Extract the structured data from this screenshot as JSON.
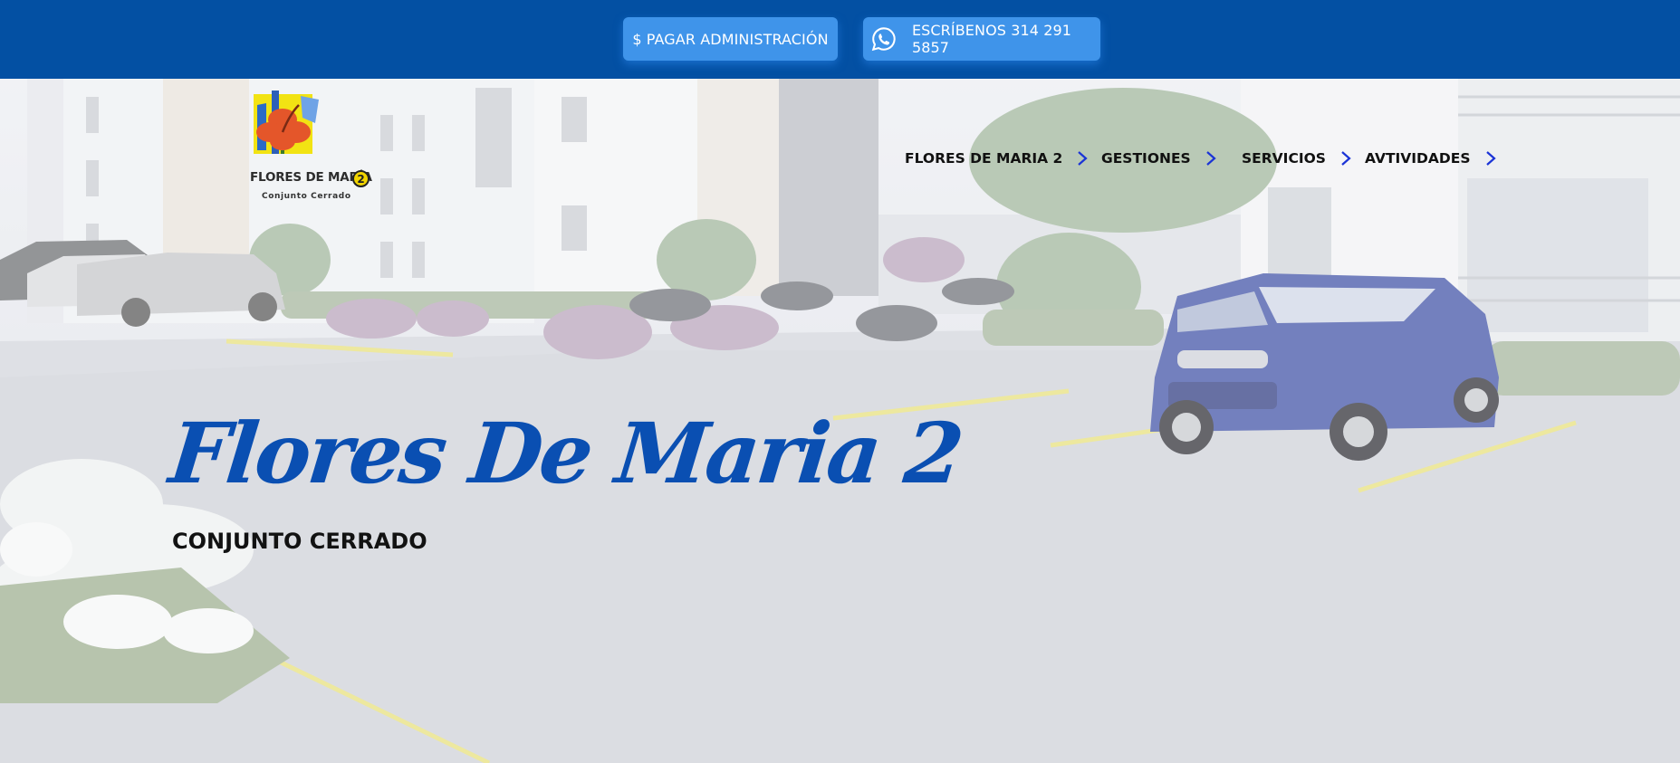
{
  "topbar": {
    "pay_button": "$ PAGAR ADMINISTRACIÓN",
    "whatsapp_button": "ESCRÍBENOS 314 291 5857",
    "whatsapp_icon": "whatsapp-icon",
    "background_color": "#0350a3",
    "button_color": "#3f94ea"
  },
  "logo": {
    "name": "FLORES DE MARÍA",
    "number": "2",
    "tagline": "Conjunto Cerrado"
  },
  "nav": {
    "items": [
      {
        "label": "FLORES DE MARIA 2",
        "icon": "chevron-right-icon"
      },
      {
        "label": "GESTIONES",
        "icon": "chevron-right-icon"
      },
      {
        "label": "SERVICIOS",
        "icon": "chevron-right-icon"
      },
      {
        "label": "AVTIVIDADES",
        "icon": "chevron-right-icon"
      }
    ],
    "chevron_color": "#1a33d6"
  },
  "hero": {
    "title": "Flores De Maria 2",
    "subtitle": "CONJUNTO CERRADO",
    "title_color": "#0a4fb2"
  }
}
